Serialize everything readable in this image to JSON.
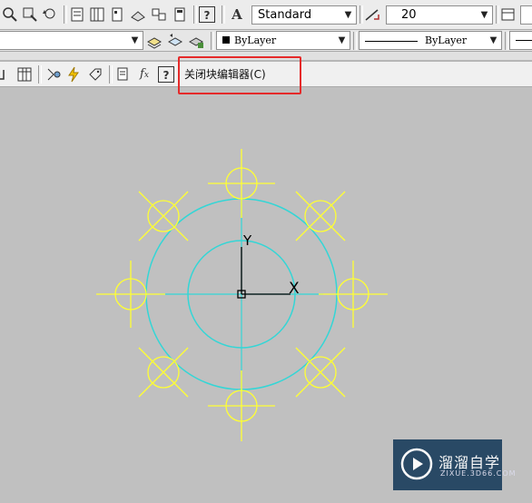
{
  "toolbar1": {
    "text_style": "Standard",
    "dim_size": "20"
  },
  "toolbar2": {
    "color": "ByLayer",
    "linetype": "ByLayer"
  },
  "block_editor": {
    "close_label": "关闭块编辑器(C)"
  },
  "drawing": {
    "ucs_y_label": "Y",
    "ucs_x_label": "X",
    "colors": {
      "outer_circles": "#33d6d6",
      "holes": "#ffff33",
      "ucs": "#000000"
    }
  },
  "watermark": {
    "title": "溜溜自学",
    "subtitle": "ZIXUE.3D66.COM"
  }
}
